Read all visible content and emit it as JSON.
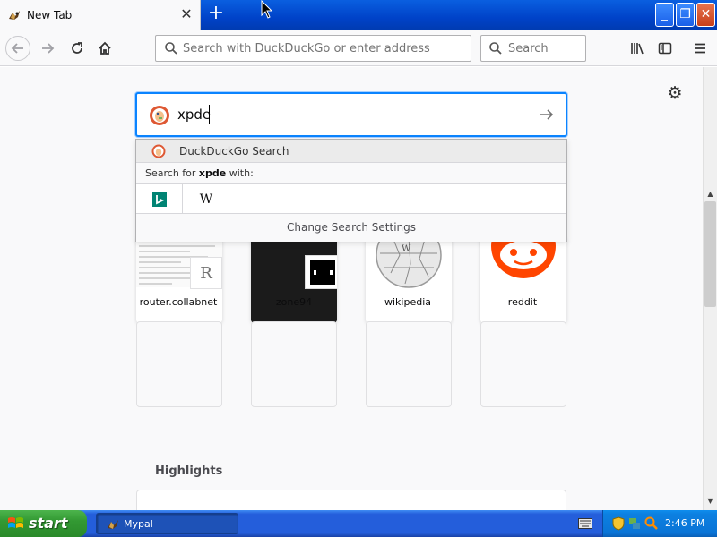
{
  "tab": {
    "title": "New Tab",
    "close_symbol": "✕",
    "new_tab_symbol": "+"
  },
  "window_controls": {
    "minimize": "_",
    "maximize": "❐",
    "close": "✕"
  },
  "toolbar": {
    "url_placeholder": "Search with DuckDuckGo or enter address",
    "search_placeholder": "Search"
  },
  "newtab_search": {
    "value": "xpde",
    "popup": {
      "engine_label": "DuckDuckGo Search",
      "search_for_prefix": "Search for ",
      "search_for_term": "xpde",
      "search_for_suffix": " with:",
      "alt_engines": [
        "bing-icon",
        "wikipedia-icon"
      ],
      "wikipedia_glyph": "W",
      "change_settings": "Change Search Settings"
    }
  },
  "top_sites": [
    {
      "label": "router.collabnet",
      "badge": "R"
    },
    {
      "label": "zone94"
    },
    {
      "label": "wikipedia"
    },
    {
      "label": "reddit"
    }
  ],
  "highlights": {
    "title": "Highlights"
  },
  "taskbar": {
    "start_label": "start",
    "window_label": "Mypal",
    "clock": "2:46 PM"
  },
  "colors": {
    "accent": "#0a84ff",
    "taskbar": "#245edb",
    "start": "#339933",
    "reddit": "#ff4500"
  }
}
